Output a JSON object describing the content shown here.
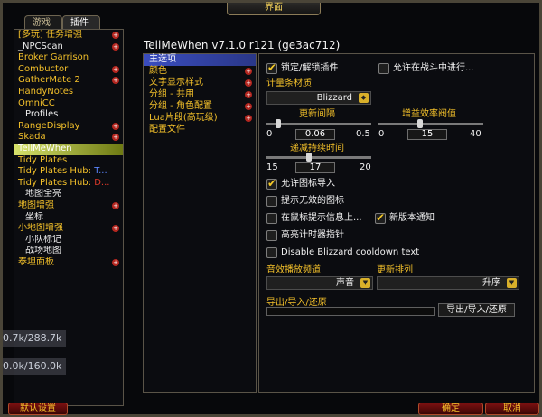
{
  "window": {
    "title": "界面"
  },
  "top_tabs": [
    {
      "label": "游戏"
    },
    {
      "label": "插件"
    }
  ],
  "addons": [
    {
      "label": "[多玩] 任务增强",
      "color": "yellow",
      "plus": true,
      "child": false
    },
    {
      "label": "_NPCScan",
      "color": "white",
      "plus": true,
      "child": false
    },
    {
      "label": "Broker Garrison",
      "color": "yellow",
      "plus": false,
      "child": false
    },
    {
      "label": "Combuctor",
      "color": "yellow",
      "plus": true,
      "child": false
    },
    {
      "label": "GatherMate 2",
      "color": "yellow",
      "plus": true,
      "child": false
    },
    {
      "label": "HandyNotes",
      "color": "yellow",
      "plus": false,
      "child": false
    },
    {
      "label": "OmniCC",
      "color": "yellow",
      "plus": false,
      "child": false
    },
    {
      "label": "Profiles",
      "color": "white",
      "plus": false,
      "child": true
    },
    {
      "label": "RangeDisplay",
      "color": "yellow",
      "plus": true,
      "child": false
    },
    {
      "label": "Skada",
      "color": "yellow",
      "plus": true,
      "child": false
    },
    {
      "label": "TellMeWhen",
      "color": "white",
      "plus": false,
      "child": false,
      "selected": true
    },
    {
      "label": "Tidy Plates",
      "color": "yellow",
      "plus": false,
      "child": false
    },
    {
      "label": "Tidy Plates Hub: ",
      "suffix": "T...",
      "suffix_color": "blue",
      "color": "yellow",
      "plus": false,
      "child": false
    },
    {
      "label": "Tidy Plates Hub: ",
      "suffix": "D...",
      "suffix_color": "red",
      "color": "yellow",
      "plus": false,
      "child": false
    },
    {
      "label": "地图全亮",
      "color": "white",
      "plus": false,
      "child": true
    },
    {
      "label": "地图增强",
      "color": "yellow",
      "plus": true,
      "child": false
    },
    {
      "label": "坐标",
      "color": "white",
      "plus": false,
      "child": true
    },
    {
      "label": "小地图增强",
      "color": "yellow",
      "plus": true,
      "child": false
    },
    {
      "label": "小队标记",
      "color": "white",
      "plus": false,
      "child": true
    },
    {
      "label": "战场地图",
      "color": "white",
      "plus": false,
      "child": true
    },
    {
      "label": "泰坦面板",
      "color": "yellow",
      "plus": true,
      "child": false
    }
  ],
  "main": {
    "title": "TellMeWhen v7.1.0 r121 (ge3ac712)",
    "categories": [
      {
        "label": "主选项",
        "plus": false,
        "active": true
      },
      {
        "label": "颜色",
        "plus": true
      },
      {
        "label": "文字显示样式",
        "plus": true
      },
      {
        "label": "分组 - 共用",
        "plus": true
      },
      {
        "label": "分组 - 角色配置",
        "plus": true
      },
      {
        "label": "Lua片段(高玩级)",
        "plus": true
      },
      {
        "label": "配置文件",
        "plus": false
      }
    ],
    "options": {
      "lock_unlock": {
        "label": "锁定/解锁插件",
        "checked": true
      },
      "allow_in_combat": {
        "label": "允许在战斗中进行...",
        "checked": false
      },
      "bar_texture": {
        "label": "计量条材质",
        "value": "Blizzard"
      },
      "update_interval": {
        "label": "更新间隔",
        "min": "0",
        "max": "0.5",
        "value": "0.06"
      },
      "effect_threshold": {
        "label": "增益效率阀值",
        "min": "0",
        "max": "40",
        "value": "15"
      },
      "decay_duration": {
        "label": "递减持续时间",
        "min": "15",
        "max": "20",
        "value": "17"
      },
      "allow_icon_import": {
        "label": "允许图标导入",
        "checked": true
      },
      "warn_invalid_icons": {
        "label": "提示无效的图标",
        "checked": false
      },
      "mouseover_tooltip": {
        "label": "在鼠标提示信息上...",
        "checked": false
      },
      "new_version_notice": {
        "label": "新版本通知",
        "checked": true
      },
      "highlight_timer": {
        "label": "高亮计时器指针",
        "checked": false
      },
      "disable_blizzard_cd": {
        "label": "Disable Blizzard cooldown text",
        "checked": false
      },
      "sound_channel": {
        "label": "音效播放频道",
        "value": "声音"
      },
      "update_order": {
        "label": "更新排列",
        "value": "升序"
      },
      "export_import": {
        "label": "导出/导入/还原",
        "button_label": "导出/导入/还原"
      }
    }
  },
  "buttons": {
    "defaults": "默认设置",
    "ok": "确定",
    "cancel": "取消"
  },
  "background": {
    "stat1": "0.7k/288.7k",
    "stat2": "0.0k/160.0k"
  }
}
